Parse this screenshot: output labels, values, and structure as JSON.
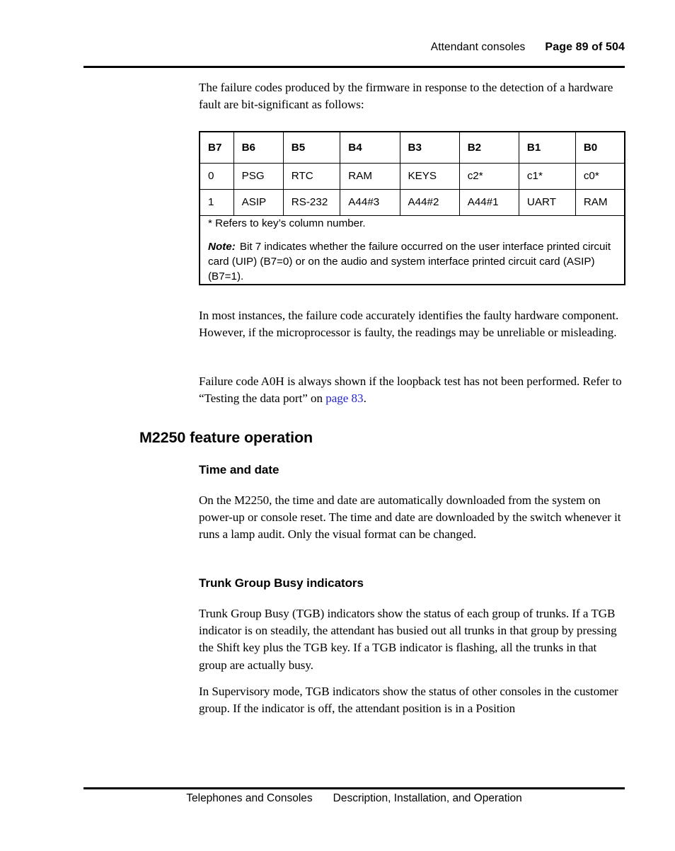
{
  "header": {
    "chapter": "Attendant consoles",
    "folio": "Page 89 of 504"
  },
  "intro_paragraph": "The failure codes produced by the firmware in response to the detection of a hardware fault are bit-significant as follows:",
  "table": {
    "headers": [
      "B7",
      "B6",
      "B5",
      "B4",
      "B3",
      "B2",
      "B1",
      "B0"
    ],
    "rows": [
      [
        "0",
        "PSG",
        "RTC",
        "RAM",
        "KEYS",
        "c2*",
        "c1*",
        "c0*"
      ],
      [
        "1",
        "ASIP",
        "RS-232",
        "A44#3",
        "A44#2",
        "A44#1",
        "UART",
        "RAM"
      ]
    ],
    "footnote": "* Refers to key’s column number.",
    "note_label": "Note:",
    "note_text": "Bit 7 indicates whether the failure occurred on the user interface printed circuit card (UIP) (B7=0) or on the audio and system interface printed circuit card (ASIP) (B7=1)."
  },
  "paragraph_reliability": "In most instances, the failure code accurately identifies the faulty hardware component. However, if the microprocessor is faulty, the readings may be unreliable or misleading.",
  "paragraph_loopback": {
    "before_link": "Failure code A0H is always shown if the loopback test has not been performed. Refer to “Testing the data port” on ",
    "link_text": "page 83",
    "after_link": ".",
    "link_color": "#2424cc"
  },
  "section_heading": "M2250 feature operation",
  "subsection_time": {
    "heading": "Time and date",
    "paragraph": "On the M2250, the time and date are automatically downloaded from the system on power-up or console reset. The time and date are downloaded by the switch whenever it runs a lamp audit. Only the visual format can be changed."
  },
  "subsection_tgb": {
    "heading": "Trunk Group Busy indicators",
    "paragraph_1": "Trunk Group Busy (TGB) indicators show the status of each group of trunks. If a TGB indicator is on steadily, the attendant has busied out all trunks in that group by pressing the Shift key plus the TGB key. If a TGB indicator is flashing, all the trunks in that group are actually busy.",
    "paragraph_2": "In Supervisory mode, TGB indicators show the status of other consoles in the customer group. If the indicator is off, the attendant position is in a Position"
  },
  "footer": {
    "left": "Telephones and Consoles",
    "right": "Description, Installation, and Operation"
  }
}
